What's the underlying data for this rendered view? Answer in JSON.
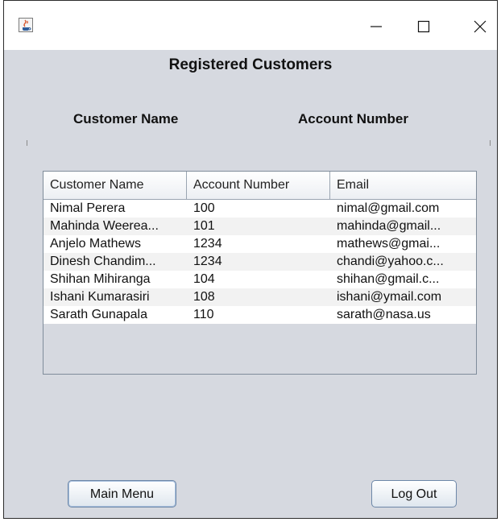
{
  "window": {
    "title": "",
    "controls": {
      "minimize": "minimize-icon",
      "maximize": "maximize-icon",
      "close": "close-icon"
    }
  },
  "main": {
    "heading": "Registered Customers",
    "customer_name_label": "Customer Name",
    "account_number_label": "Account Number"
  },
  "table": {
    "columns": [
      "Customer Name",
      "Account Number",
      "Email"
    ],
    "rows": [
      [
        "Nimal Perera",
        "100",
        "nimal@gmail.com"
      ],
      [
        "Mahinda Weerea...",
        "101",
        "mahinda@gmail..."
      ],
      [
        "Anjelo Mathews",
        "1234",
        "mathews@gmai..."
      ],
      [
        "Dinesh Chandim...",
        "1234",
        "chandi@yahoo.c..."
      ],
      [
        "Shihan Mihiranga",
        "104",
        "shihan@gmail.c..."
      ],
      [
        "Ishani Kumarasiri",
        "108",
        "ishani@ymail.com"
      ],
      [
        "Sarath Gunapala",
        "110",
        "sarath@nasa.us"
      ]
    ]
  },
  "buttons": {
    "main_menu": "Main Menu",
    "log_out": "Log Out"
  },
  "colors": {
    "background": "#d6d9e0",
    "accent_border": "#6d87a8"
  }
}
